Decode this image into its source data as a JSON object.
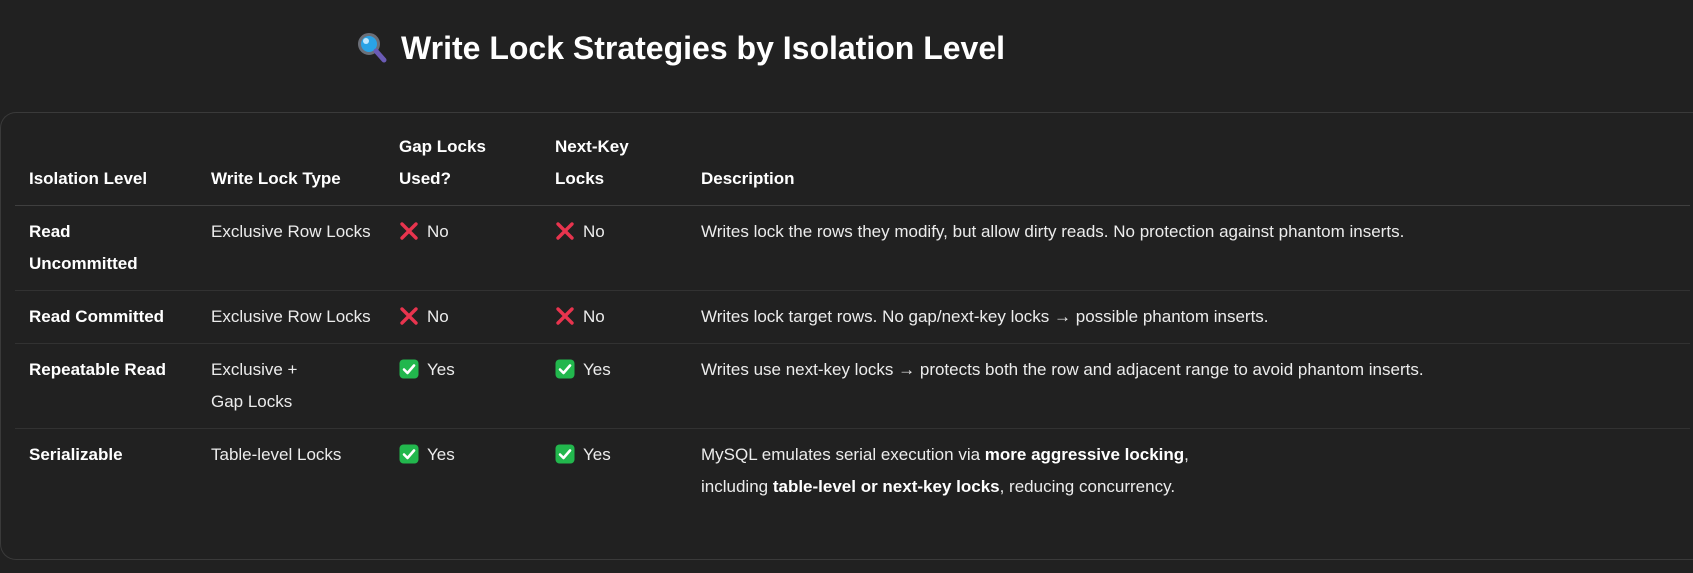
{
  "heading": {
    "icon": "magnifying-glass-icon",
    "title": "Write Lock Strategies by Isolation Level"
  },
  "table": {
    "headers": {
      "isolation_level": "Isolation Level",
      "write_lock_type": "Write Lock Type",
      "gap_locks_line1": "Gap Locks",
      "gap_locks_line2": "Used?",
      "next_key_line1": "Next-Key",
      "next_key_line2": "Locks",
      "description": "Description"
    },
    "rows": [
      {
        "level_line1": "Read",
        "level_line2": "Uncommitted",
        "lock_type": "Exclusive Row Locks",
        "gap_icon": "cross-icon",
        "gap": "No",
        "nextkey_icon": "cross-icon",
        "nextkey": "No",
        "description": "Writes lock the rows they modify, but allow dirty reads. No protection against phantom inserts."
      },
      {
        "level": "Read Committed",
        "lock_type": "Exclusive Row Locks",
        "gap_icon": "cross-icon",
        "gap": "No",
        "nextkey_icon": "cross-icon",
        "nextkey": "No",
        "description": "Writes lock target rows. No gap/next-key locks → possible phantom inserts."
      },
      {
        "level": "Repeatable Read",
        "lock_type_line1": "Exclusive +",
        "lock_type_line2": "Gap Locks",
        "gap_icon": "check-icon",
        "gap": "Yes",
        "nextkey_icon": "check-icon",
        "nextkey": "Yes",
        "description": "Writes use next-key locks → protects both the row and adjacent range to avoid phantom inserts."
      },
      {
        "level": "Serializable",
        "lock_type": "Table-level Locks",
        "gap_icon": "check-icon",
        "gap": "Yes",
        "nextkey_icon": "check-icon",
        "nextkey": "Yes",
        "description_parts": {
          "p1": "MySQL emulates serial execution via ",
          "b1": "more aggressive locking",
          "p2": ",",
          "p3": "including ",
          "b2": "table-level or next-key locks",
          "p4": ", reducing concurrency."
        }
      }
    ]
  },
  "colors": {
    "background": "#212121",
    "cross": "#e8344e",
    "check": "#22b74d"
  }
}
